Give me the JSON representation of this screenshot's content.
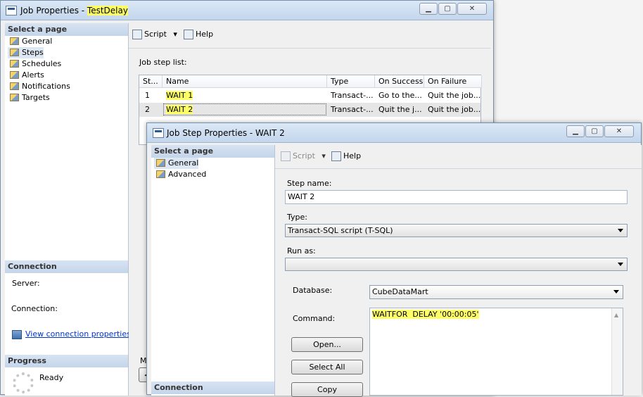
{
  "job_window": {
    "title_prefix": "Job Properties - ",
    "title_name": "TestDelay",
    "select_page_header": "Select a page",
    "pages": [
      "General",
      "Steps",
      "Schedules",
      "Alerts",
      "Notifications",
      "Targets"
    ],
    "selected_page": "Steps",
    "toolbar": {
      "script": "Script",
      "help": "Help"
    },
    "step_list_label": "Job step list:",
    "columns": [
      "St...",
      "Name",
      "Type",
      "On Success",
      "On Failure"
    ],
    "rows": [
      [
        "1",
        "WAIT 1",
        "Transact-...",
        "Go to the...",
        "Quit the job..."
      ],
      [
        "2",
        "WAIT 2",
        "Transact-...",
        "Quit the j...",
        "Quit the job..."
      ]
    ],
    "connection_header": "Connection",
    "server_label": "Server:",
    "connection_label": "Connection:",
    "view_connection_link": "View connection properties",
    "progress_header": "Progress",
    "progress_status": "Ready",
    "partial_label": "M"
  },
  "step_window": {
    "title": "Job Step Properties - WAIT 2",
    "select_page_header": "Select a page",
    "pages": [
      "General",
      "Advanced"
    ],
    "selected_page": "General",
    "toolbar": {
      "script": "Script",
      "help": "Help"
    },
    "step_name_label": "Step name:",
    "step_name_value": "WAIT 2",
    "type_label": "Type:",
    "type_value": "Transact-SQL script (T-SQL)",
    "run_as_label": "Run as:",
    "run_as_value": "",
    "database_label": "Database:",
    "database_value": "CubeDataMart",
    "command_label": "Command:",
    "command_value": "WAITFOR  DELAY '00:00:05'",
    "buttons": {
      "open": "Open...",
      "select_all": "Select All",
      "copy": "Copy"
    },
    "connection_header": "Connection"
  },
  "colors": {
    "highlight": "#ffff66",
    "title_bar": "#c3d6ec",
    "link": "#0033cc"
  }
}
